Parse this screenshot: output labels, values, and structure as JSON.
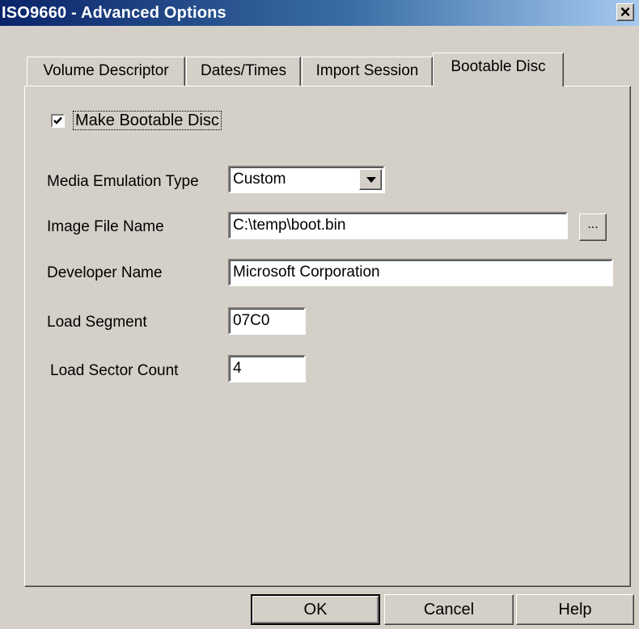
{
  "window": {
    "title": "ISO9660 - Advanced Options",
    "close_glyph": "×"
  },
  "tabs": [
    {
      "label": "Volume Descriptor",
      "active": false
    },
    {
      "label": "Dates/Times",
      "active": false
    },
    {
      "label": "Import Session",
      "active": false
    },
    {
      "label": "Bootable Disc",
      "active": true
    }
  ],
  "bootable": {
    "make_bootable_label": "Make Bootable Disc",
    "make_bootable_checked": true,
    "media_emulation_label": "Media Emulation Type",
    "media_emulation_value": "Custom",
    "image_file_label": "Image File Name",
    "image_file_value": "C:\\temp\\boot.bin",
    "browse_label": "...",
    "developer_label": "Developer Name",
    "developer_value": "Microsoft Corporation",
    "load_segment_label": "Load Segment",
    "load_segment_value": "07C0",
    "sector_count_label": "Load Sector Count",
    "sector_count_value": "4"
  },
  "buttons": {
    "ok": "OK",
    "cancel": "Cancel",
    "help": "Help"
  },
  "colors": {
    "face": "#d4d0c8",
    "title_start": "#0a246a",
    "title_end": "#a6caf0"
  }
}
